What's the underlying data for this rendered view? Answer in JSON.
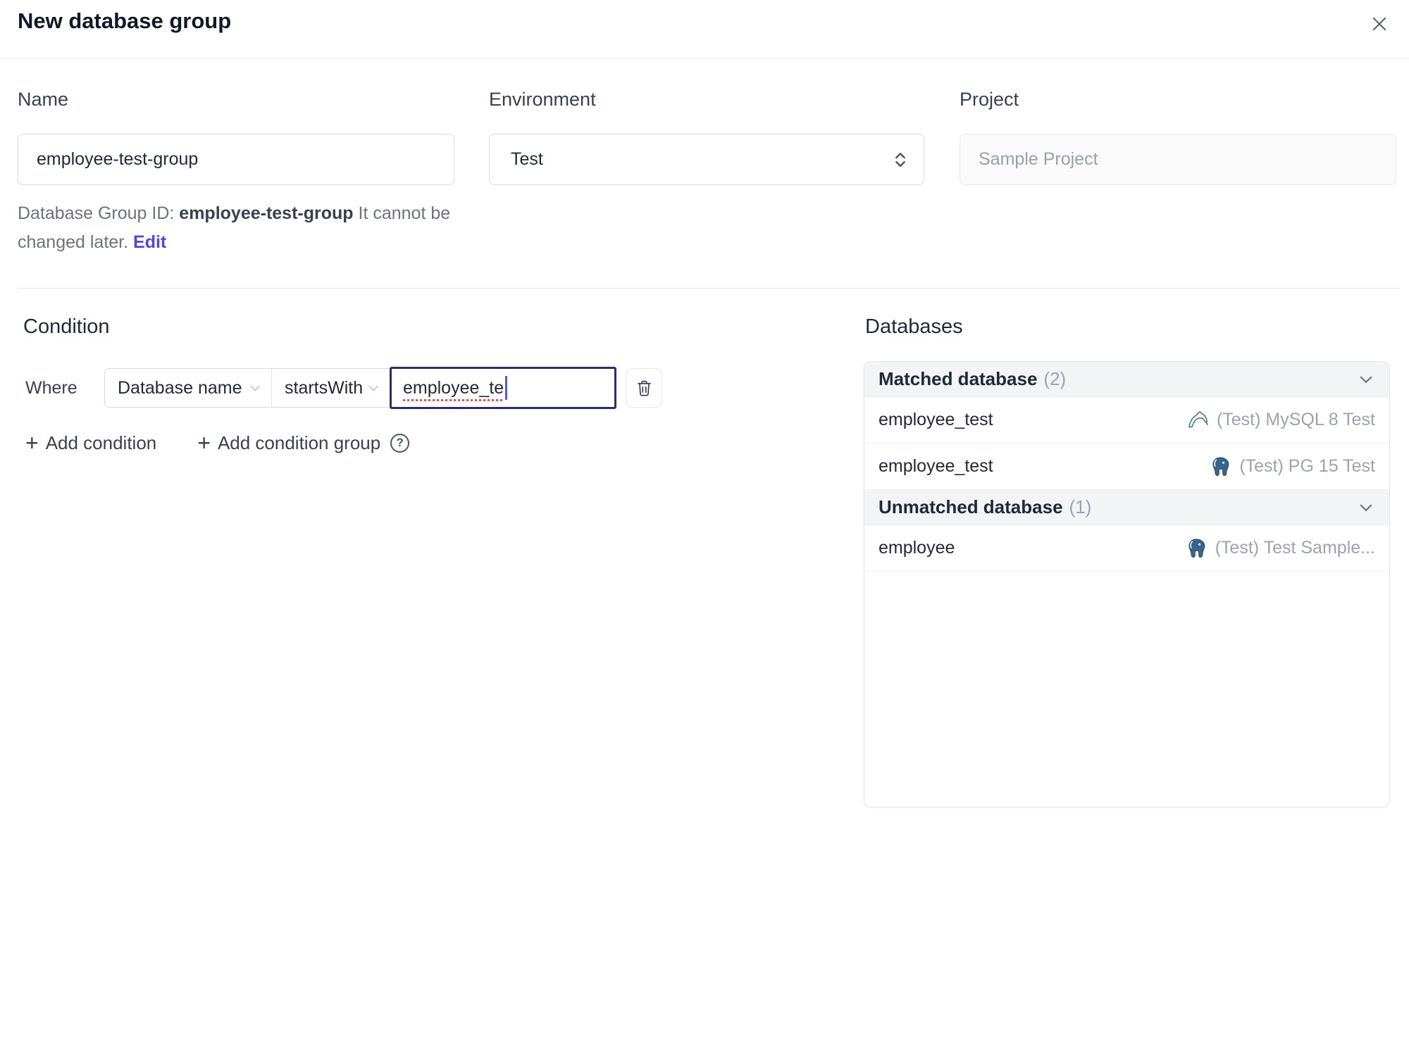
{
  "dialog": {
    "title": "New database group"
  },
  "form": {
    "name": {
      "label": "Name",
      "value": "employee-test-group"
    },
    "environment": {
      "label": "Environment",
      "value": "Test"
    },
    "project": {
      "label": "Project",
      "value": "Sample Project"
    },
    "group_id_note": {
      "prefix": "Database Group ID: ",
      "id": "employee-test-group",
      "middle": " It cannot be changed later. ",
      "edit_label": "Edit"
    }
  },
  "condition": {
    "title": "Condition",
    "where_label": "Where",
    "factor": "Database name",
    "operator": "startsWith",
    "value": "employee_te",
    "plus": "+",
    "add_condition": "Add condition",
    "add_condition_group": "Add condition group",
    "help": "?"
  },
  "databases": {
    "title": "Databases",
    "matched": {
      "label": "Matched database",
      "count": "(2)",
      "rows": [
        {
          "name": "employee_test",
          "engine": "mysql",
          "instance": "(Test) MySQL 8 Test"
        },
        {
          "name": "employee_test",
          "engine": "postgresql",
          "instance": "(Test) PG 15 Test"
        }
      ]
    },
    "unmatched": {
      "label": "Unmatched database",
      "count": "(1)",
      "rows": [
        {
          "name": "employee",
          "engine": "postgresql",
          "instance": "(Test) Test Sample..."
        }
      ]
    }
  },
  "colors": {
    "accent": "#4f46e5",
    "focused_input_border": "#2d2a70",
    "mysql_icon": "#3d6e93",
    "postgres_icon": "#336791",
    "section_header_bg": "#f3f4f6",
    "muted_text": "#9ca3af"
  }
}
